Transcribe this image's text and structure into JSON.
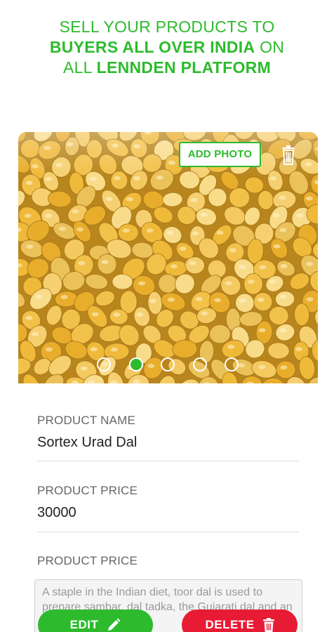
{
  "header": {
    "line1": "SELL YOUR PRODUCTS TO",
    "line2_bold": "BUYERS ALL OVER INDIA",
    "line2_rest": " ON",
    "line3_lead": "ALL ",
    "line3_bold": "LENNDEN PLATFORM"
  },
  "photo": {
    "add_photo_label": "ADD PHOTO",
    "carousel": {
      "count": 5,
      "active_index": 1
    }
  },
  "fields": {
    "name_label": "PRODUCT NAME",
    "name_value": "Sortex Urad Dal",
    "price_label": "PRODUCT PRICE",
    "price_value": "30000",
    "desc_label": "PRODUCT PRICE",
    "desc_value": "A staple in the Indian diet, toor dal is used to prepare sambar, dal tadka, the Gujarati dal and an"
  },
  "actions": {
    "edit_label": "EDIT",
    "delete_label": "DELETE"
  },
  "colors": {
    "accent": "#2dbb2d",
    "danger": "#e81b34"
  },
  "icons": [
    "trash-icon",
    "pencil-icon"
  ]
}
